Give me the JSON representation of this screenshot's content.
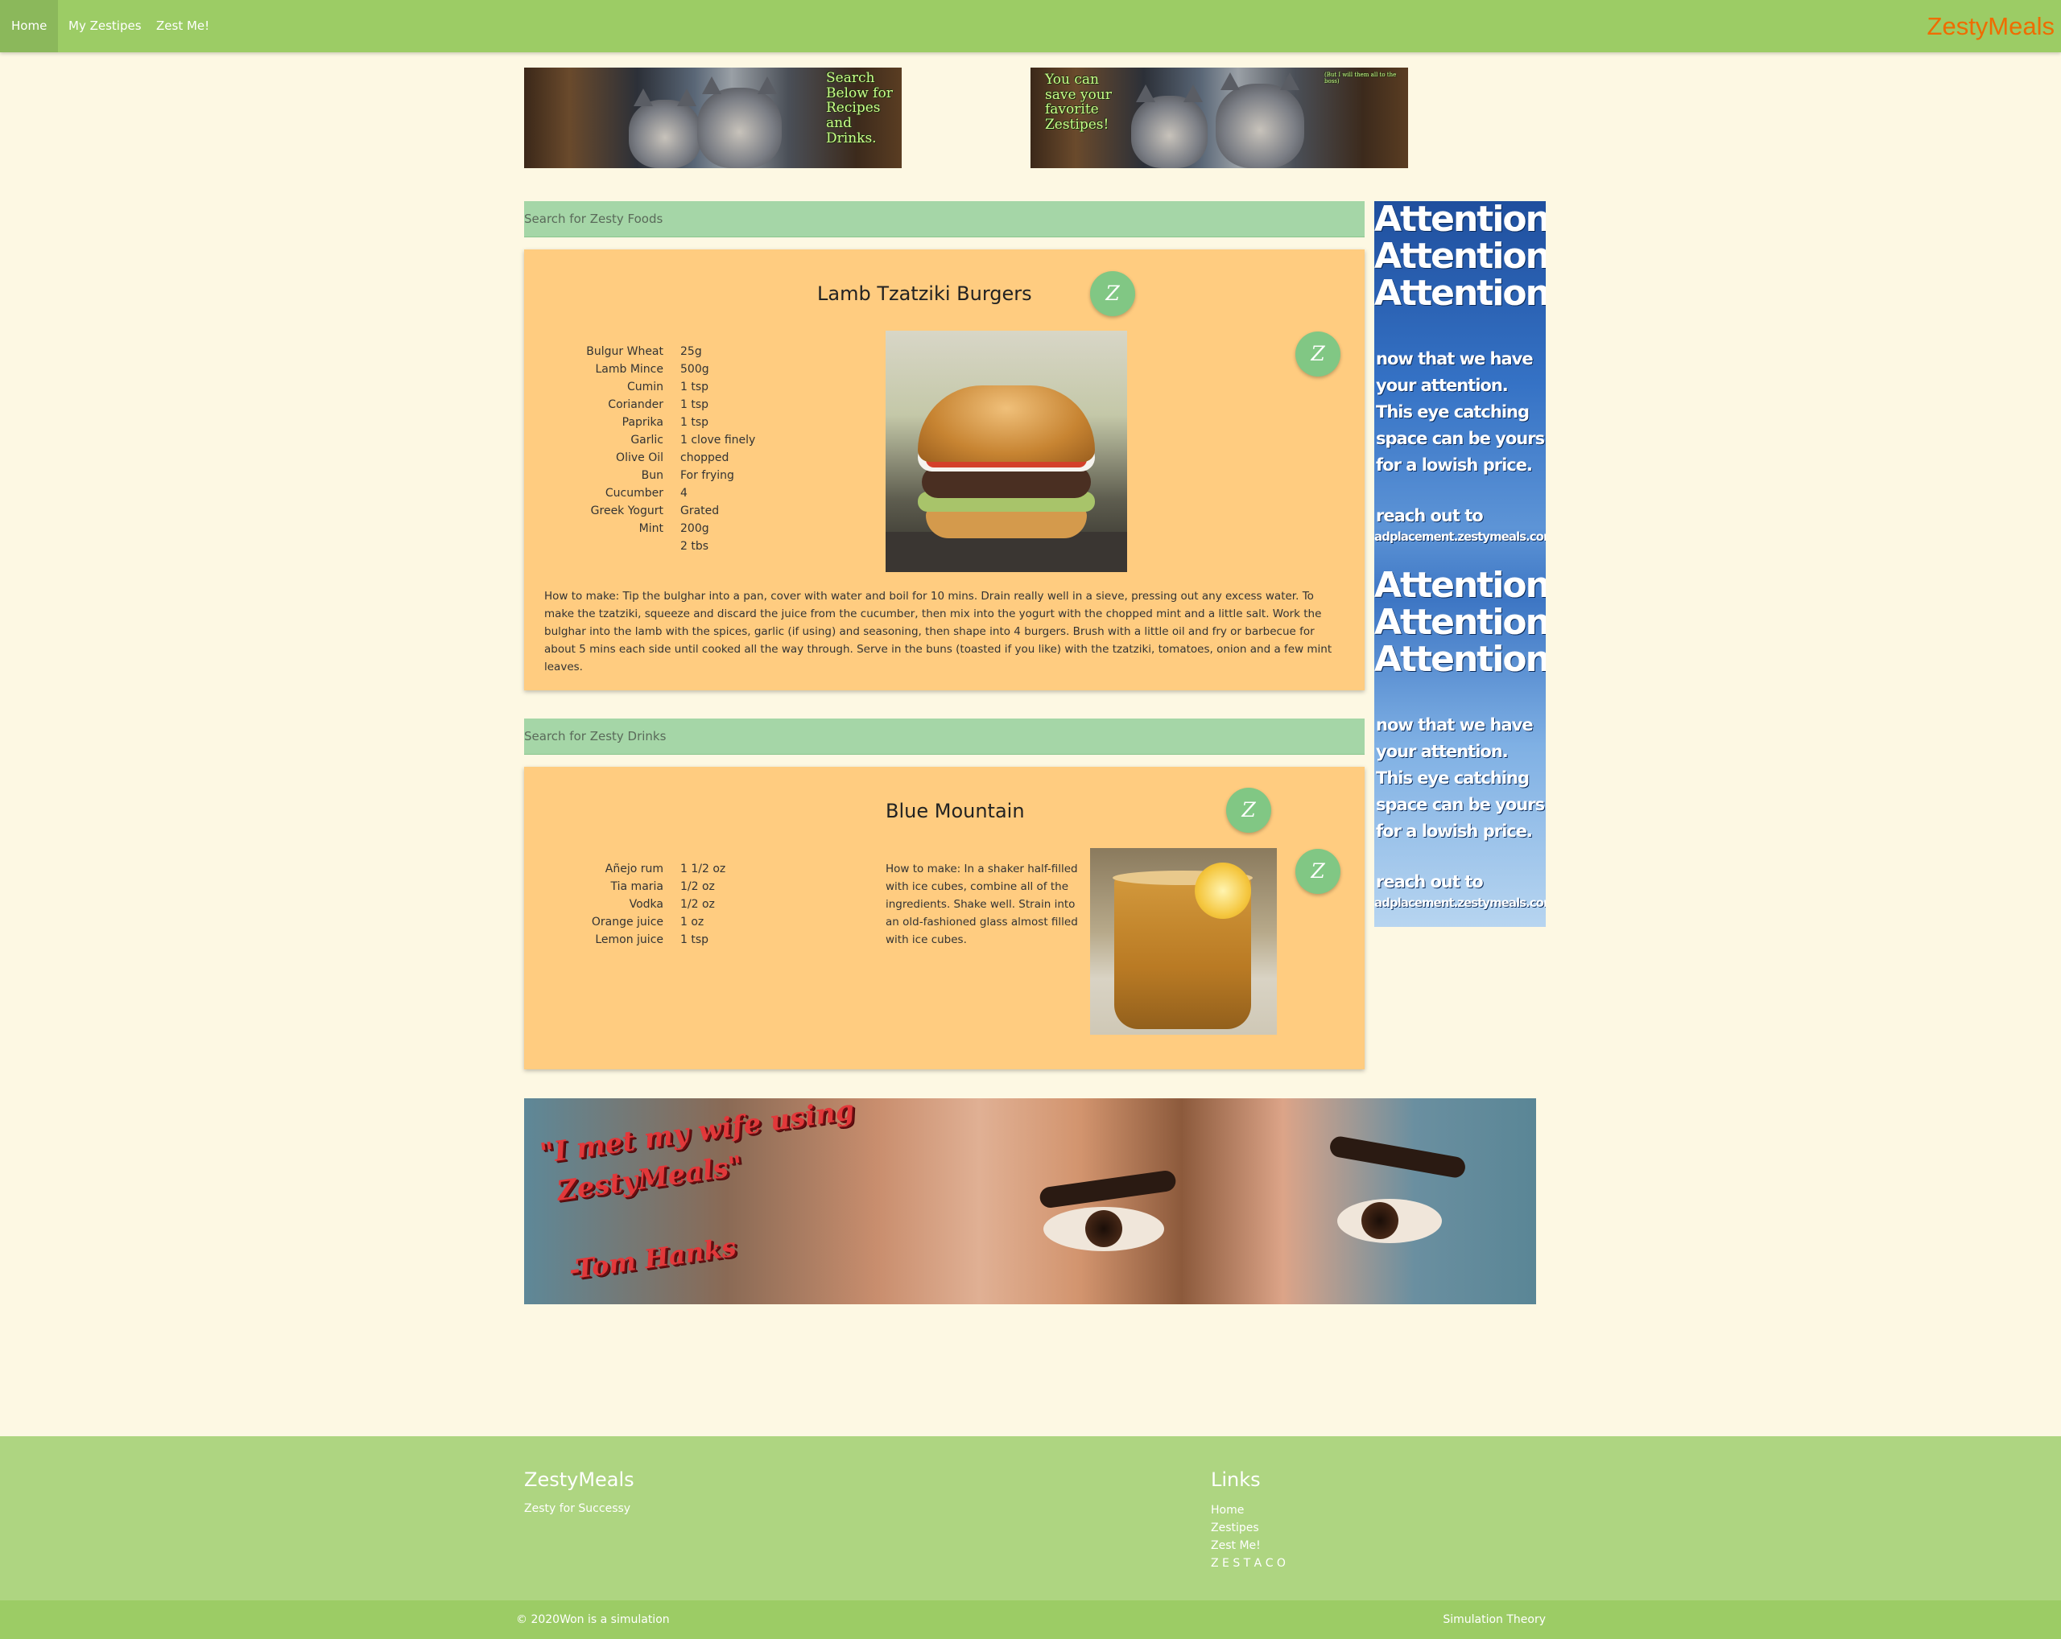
{
  "nav": {
    "items": [
      {
        "label": "Home",
        "active": true
      },
      {
        "label": "My Zestipes",
        "active": false
      },
      {
        "label": "Zest Me!",
        "active": false
      }
    ],
    "brand": "ZestyMeals"
  },
  "banners": {
    "left_text": "Search Below for Recipes and Drinks.",
    "right_text": "You can save your favorite Zestipes!",
    "right_small_text": "(But I will them all to the boss)"
  },
  "food_search": {
    "placeholder": "Search for Zesty Foods"
  },
  "food_card": {
    "title": "Lamb Tzatziki Burgers",
    "z_button": "Z",
    "ingredient_names": [
      "Bulgur Wheat",
      "Lamb Mince",
      "Cumin",
      "Coriander",
      "Paprika",
      "Garlic",
      "Olive Oil",
      "Bun",
      "Cucumber",
      "Greek Yogurt",
      "Mint"
    ],
    "ingredient_amounts": [
      "25g",
      "500g",
      "1 tsp",
      "1 tsp",
      "1 tsp",
      "1 clove finely",
      "chopped",
      "For frying",
      "4",
      "Grated",
      "200g",
      "2 tbs"
    ],
    "instructions": "How to make: Tip the bulghar into a pan, cover with water and boil for 10 mins. Drain really well in a sieve, pressing out any excess water. To make the tzatziki, squeeze and discard the juice from the cucumber, then mix into the yogurt with the chopped mint and a little salt. Work the bulghar into the lamb with the spices, garlic (if using) and seasoning, then shape into 4 burgers. Brush with a little oil and fry or barbecue for about 5 mins each side until cooked all the way through. Serve in the buns (toasted if you like) with the tzatziki, tomatoes, onion and a few mint leaves."
  },
  "drink_search": {
    "placeholder": "Search for Zesty Drinks"
  },
  "drink_card": {
    "title": "Blue Mountain",
    "z_button": "Z",
    "ingredient_names": [
      "Añejo rum",
      "Tia maria",
      "Vodka",
      "Orange juice",
      "Lemon juice"
    ],
    "ingredient_amounts": [
      "1 1/2 oz",
      "1/2 oz",
      "1/2 oz",
      "1 oz",
      "1 tsp"
    ],
    "instructions": "How to make: In a shaker half-filled with ice cubes, combine all of the ingredients. Shake well. Strain into an old-fashioned glass almost filled with ice cubes."
  },
  "side_ad": {
    "attention": "Attention!",
    "body": "now that we have your attention. This eye catching space can be yours for a lowish price.",
    "reach": "reach out to",
    "email": "adplacement.zestymeals.com"
  },
  "bottom_ad": {
    "quote_line1": "\"I met my wife using",
    "quote_line2": "ZestyMeals\"",
    "quote_author": "-Tom Hanks"
  },
  "footer": {
    "brand_title": "ZestyMeals",
    "tagline": "Zesty for Successy",
    "links_title": "Links",
    "links": [
      "Home",
      "Zestipes",
      "Zest Me!",
      "Z E S T A C O"
    ],
    "copyright": "© 2020Won is a simulation",
    "right_link": "Simulation Theory"
  },
  "colors": {
    "navbar": "#9ccc65",
    "brand": "#ef6c00",
    "card": "#ffcc80",
    "search": "#a5d6a7",
    "z_button": "#81c784",
    "footer": "#aed581",
    "background": "#fdf8e3"
  }
}
